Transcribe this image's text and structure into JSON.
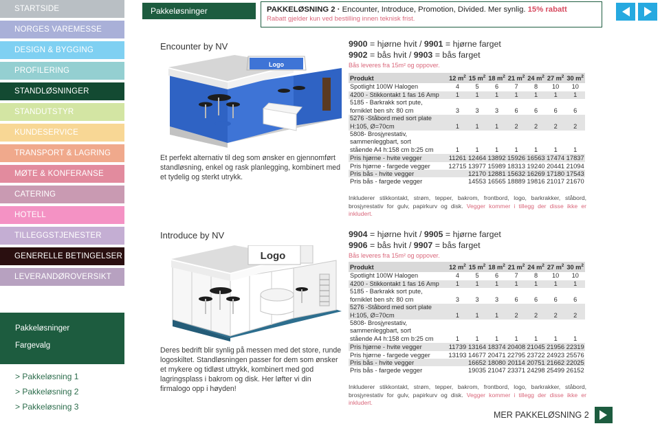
{
  "sidebar": {
    "items": [
      {
        "label": "STARTSIDE",
        "bg": "#b9bfc4",
        "text": "#ffffff"
      },
      {
        "label": "NORGES VAREMESSE",
        "bg": "#a9b0d8",
        "text": "#ffffff"
      },
      {
        "label": "DESIGN & BYGGING",
        "bg": "#7fd0f2",
        "text": "#ffffff"
      },
      {
        "label": "PROFILERING",
        "bg": "#94cfd1",
        "text": "#ffffff"
      },
      {
        "label": "STANDLØSNINGER",
        "bg": "#134a32",
        "text": "#ffffff"
      },
      {
        "label": "STANDUTSTYR",
        "bg": "#d3e5a3",
        "text": "#ffffff"
      },
      {
        "label": "KUNDESERVICE",
        "bg": "#f8d795",
        "text": "#ffffff"
      },
      {
        "label": "TRANSPORT & LAGRING",
        "bg": "#f0a98c",
        "text": "#ffffff"
      },
      {
        "label": "MØTE & KONFERANSE",
        "bg": "#e28b9e",
        "text": "#ffffff"
      },
      {
        "label": "CATERING",
        "bg": "#c99ab2",
        "text": "#ffffff"
      },
      {
        "label": "HOTELL",
        "bg": "#f492c4",
        "text": "#ffffff"
      },
      {
        "label": "TILLEGGSTJENESTER",
        "bg": "#c4aed3",
        "text": "#ffffff"
      },
      {
        "label": "GENERELLE BETINGELSER",
        "bg": "#2a0f10",
        "text": "#ffffff"
      },
      {
        "label": "LEVERANDØROVERSIKT",
        "bg": "#b7a1c0",
        "text": "#ffffff"
      }
    ],
    "subpanel": {
      "items": [
        "Pakkeløsninger",
        "Fargevalg"
      ]
    },
    "links": [
      "> Pakkeløsning 1",
      "> Pakkeløsning 2",
      "> Pakkeløsning 3"
    ]
  },
  "header": {
    "section_tab": "Pakkeløsninger",
    "promo_prefix": "PAKKELØSNING 2 · ",
    "promo_main": "Encounter, Introduce, Promotion, Divided. Mer synlig. ",
    "promo_discount": "15% rabatt",
    "promo_note": "Rabatt gjelder kun ved bestilling innen teknisk frist.",
    "nav_prev_icon": "chevron-left-icon",
    "nav_next_icon": "chevron-right-icon"
  },
  "sections": [
    {
      "title": "Encounter by NV",
      "description": "Et perfekt alternativ til deg som ønsker en gjennomført standløsning, enkel og rask planlegging, kombinert med et tydelig og sterkt utrykk.",
      "code_line_1_a": "9900",
      "code_line_1_b": " = hjørne hvit / ",
      "code_line_1_c": "9901",
      "code_line_1_d": " = hjørne farget",
      "code_line_2_a": "9902",
      "code_line_2_b": " = bås hvit / ",
      "code_line_2_c": "9903",
      "code_line_2_d": " = bås farget",
      "code_note": "Bås leveres fra 15m² og oppover.",
      "footnote_main": "Inkluderer stikkontakt, strøm, tepper, bakrom, frontbord, logo, barkrakker, ståbord, brosjyrestativ for gulv, papirkurv og disk. ",
      "footnote_warn": "Vegger kommer i tillegg der disse ikke er inkludert."
    },
    {
      "title": "Introduce by NV",
      "description": "Deres bedrift blir synlig på messen med det store, runde logoskiltet. Standløsningen passer for dem som ønsker et mykere og tidløst uttrykk, kombinert med god lagringsplass i bakrom og disk. Her løfter vi din firmalogo opp i høyden!",
      "code_line_1_a": "9904",
      "code_line_1_b": " = hjørne hvit / ",
      "code_line_1_c": "9905",
      "code_line_1_d": " = hjørne farget",
      "code_line_2_a": "9906",
      "code_line_2_b": " = bås hvit / ",
      "code_line_2_c": "9907",
      "code_line_2_d": " = bås farget",
      "code_note": "Bås leveres fra 15m² og oppover.",
      "footnote_main": "Inkluderer stikkontakt, strøm, tepper, bakrom, frontbord, logo, barkrakker, ståbord, brosjyrestativ for gulv, papirkurv og disk. ",
      "footnote_warn": "Vegger kommer i tillegg der disse ikke er inkludert."
    }
  ],
  "table": {
    "header_label": "Produkt",
    "columns": [
      "12 m²",
      "15 m²",
      "18 m²",
      "21 m²",
      "24 m²",
      "27 m²",
      "30 m²"
    ],
    "rows": [
      {
        "label": "Spotlight 100W Halogen",
        "label2": "",
        "values": [
          "4",
          "5",
          "6",
          "7",
          "8",
          "10",
          "10"
        ]
      },
      {
        "label": "4200 - Stikkontakt 1 fas 16 Amp",
        "label2": "",
        "values": [
          "1",
          "1",
          "1",
          "1",
          "1",
          "1",
          "1"
        ]
      },
      {
        "label": "5185 - Barkrakk sort pute,",
        "label2": "forniklet ben sh: 80 cm",
        "values": [
          "3",
          "3",
          "3",
          "6",
          "6",
          "6",
          "6"
        ]
      },
      {
        "label": "5276 -Ståbord med sort plate",
        "label2": "H:105, Ø=70cm",
        "values": [
          "1",
          "1",
          "1",
          "2",
          "2",
          "2",
          "2"
        ]
      },
      {
        "label": "5808- Brosjyrestativ,",
        "label2": "sammenleggbart, sort",
        "label3": "stående A4 h:158 cm b:25 cm",
        "values": [
          "1",
          "1",
          "1",
          "1",
          "1",
          "1",
          "1"
        ]
      }
    ]
  },
  "prices": [
    {
      "rows": [
        {
          "label": "Pris hjørne - hvite vegger",
          "values": [
            "11261",
            "12464",
            "13892",
            "15926",
            "16563",
            "17474",
            "17837"
          ]
        },
        {
          "label": "Pris hjørne - fargede vegger",
          "values": [
            "12715",
            "13977",
            "15989",
            "18313",
            "19240",
            "20441",
            "21094"
          ]
        },
        {
          "label": "Pris bås - hvite vegger",
          "values": [
            "",
            "12170",
            "12881",
            "15632",
            "16269",
            "17180",
            "17543"
          ]
        },
        {
          "label": "Pris bås - fargede vegger",
          "values": [
            "",
            "14553",
            "16565",
            "18889",
            "19816",
            "21017",
            "21670"
          ]
        }
      ]
    },
    {
      "rows": [
        {
          "label": "Pris hjørne - hvite vegger",
          "values": [
            "11739",
            "13164",
            "18374",
            "20408",
            "21045",
            "21956",
            "22319"
          ]
        },
        {
          "label": "Pris hjørne - fargede vegger",
          "values": [
            "13193",
            "14677",
            "20471",
            "22795",
            "23722",
            "24923",
            "25576"
          ]
        },
        {
          "label": "Pris bås - hvite vegger",
          "values": [
            "",
            "16652",
            "18080",
            "20114",
            "20751",
            "21662",
            "22025"
          ]
        },
        {
          "label": "Pris bås - fargede vegger",
          "values": [
            "",
            "19035",
            "21047",
            "23371",
            "24298",
            "25499",
            "26152"
          ]
        }
      ]
    }
  ],
  "cta": {
    "label": "MER PAKKELØSNING 2",
    "icon": "play-arrow-icon"
  },
  "colors": {
    "brand_green": "#1d5c3f",
    "accent_blue": "#26a9e0",
    "warn_pink": "#d9667a",
    "discount_red": "#d64a5f"
  }
}
